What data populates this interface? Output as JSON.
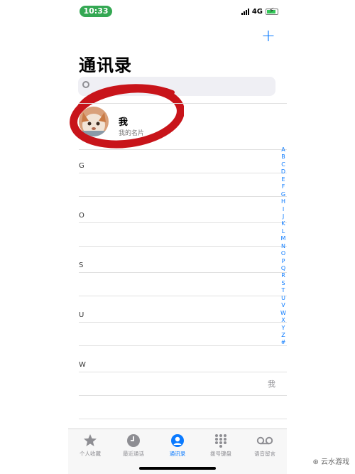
{
  "status_bar": {
    "time": "10:33",
    "network": "4G"
  },
  "header": {
    "title": "通讯录",
    "add_icon": "plus-icon"
  },
  "search": {
    "icon": "search-icon"
  },
  "my_card": {
    "name": "我",
    "subtitle": "我的名片"
  },
  "sections": [
    "G",
    "O",
    "S",
    "U",
    "W"
  ],
  "contacts": [
    {
      "section": "W",
      "name": "我"
    }
  ],
  "index_letters": [
    "A",
    "B",
    "C",
    "D",
    "E",
    "F",
    "G",
    "H",
    "I",
    "J",
    "K",
    "L",
    "M",
    "N",
    "O",
    "P",
    "Q",
    "R",
    "S",
    "T",
    "U",
    "V",
    "W",
    "X",
    "Y",
    "Z",
    "#"
  ],
  "tabbar": {
    "tabs": [
      {
        "label": "个人收藏",
        "icon": "star-icon",
        "active": false
      },
      {
        "label": "最近通话",
        "icon": "clock-icon",
        "active": false
      },
      {
        "label": "通讯录",
        "icon": "person-circle-icon",
        "active": true
      },
      {
        "label": "拨号键盘",
        "icon": "keypad-icon",
        "active": false
      },
      {
        "label": "语音留言",
        "icon": "voicemail-icon",
        "active": false
      }
    ]
  },
  "watermark": "云水游戏",
  "colors": {
    "accent": "#0a7aff",
    "time_pill": "#34a853",
    "annotation": "#c8141a"
  }
}
